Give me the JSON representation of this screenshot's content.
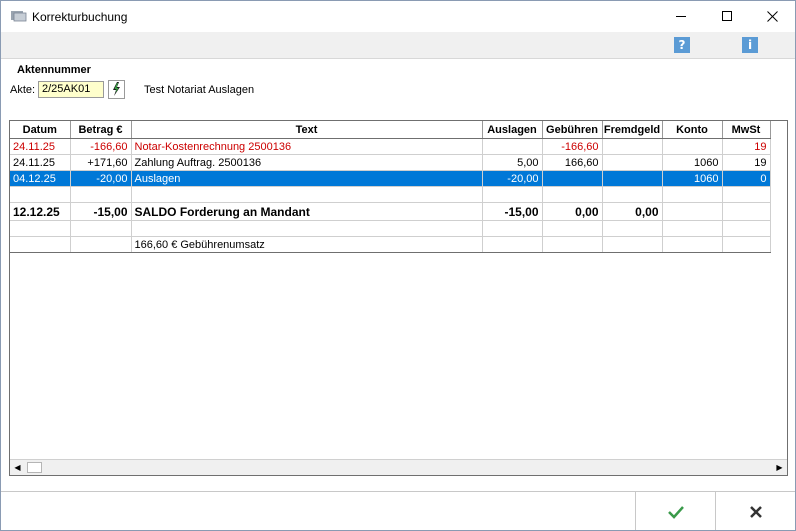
{
  "window": {
    "title": "Korrekturbuchung"
  },
  "toolbar": {
    "help_icon": "help-icon",
    "info_icon": "info-icon"
  },
  "form": {
    "section_label": "Aktennummer",
    "akte_label": "Akte:",
    "akte_value": "2/25AK01",
    "akte_description": "Test Notariat Auslagen"
  },
  "table": {
    "headers": [
      "Datum",
      "Betrag €",
      "Text",
      "Auslagen",
      "Gebühren",
      "Fremdgeld",
      "Konto",
      "MwSt"
    ],
    "rows": [
      {
        "datum": "24.11.25",
        "betrag": "-166,60",
        "text": "Notar-Kostenrechnung 2500136",
        "auslagen": "",
        "gebuehren": "-166,60",
        "fremdgeld": "",
        "konto": "",
        "mwst": "19"
      },
      {
        "datum": "24.11.25",
        "betrag": "+171,60",
        "text": "Zahlung Auftrag. 2500136",
        "auslagen": "5,00",
        "gebuehren": "166,60",
        "fremdgeld": "",
        "konto": "1060",
        "mwst": "19"
      },
      {
        "datum": "04.12.25",
        "betrag": "-20,00",
        "text": "Auslagen",
        "auslagen": "-20,00",
        "gebuehren": "",
        "fremdgeld": "",
        "konto": "1060",
        "mwst": "0"
      },
      {
        "datum": "12.12.25",
        "betrag": "-15,00",
        "text": "SALDO Forderung an Mandant",
        "auslagen": "-15,00",
        "gebuehren": "0,00",
        "fremdgeld": "0,00",
        "konto": "",
        "mwst": ""
      },
      {
        "datum": "",
        "betrag": "",
        "text": "166,60 € Gebührenumsatz",
        "auslagen": "",
        "gebuehren": "",
        "fremdgeld": "",
        "konto": "",
        "mwst": ""
      }
    ]
  },
  "colors": {
    "selection": "#0078d7",
    "negative": "#cc0000",
    "ok": "#3a9a4a"
  }
}
